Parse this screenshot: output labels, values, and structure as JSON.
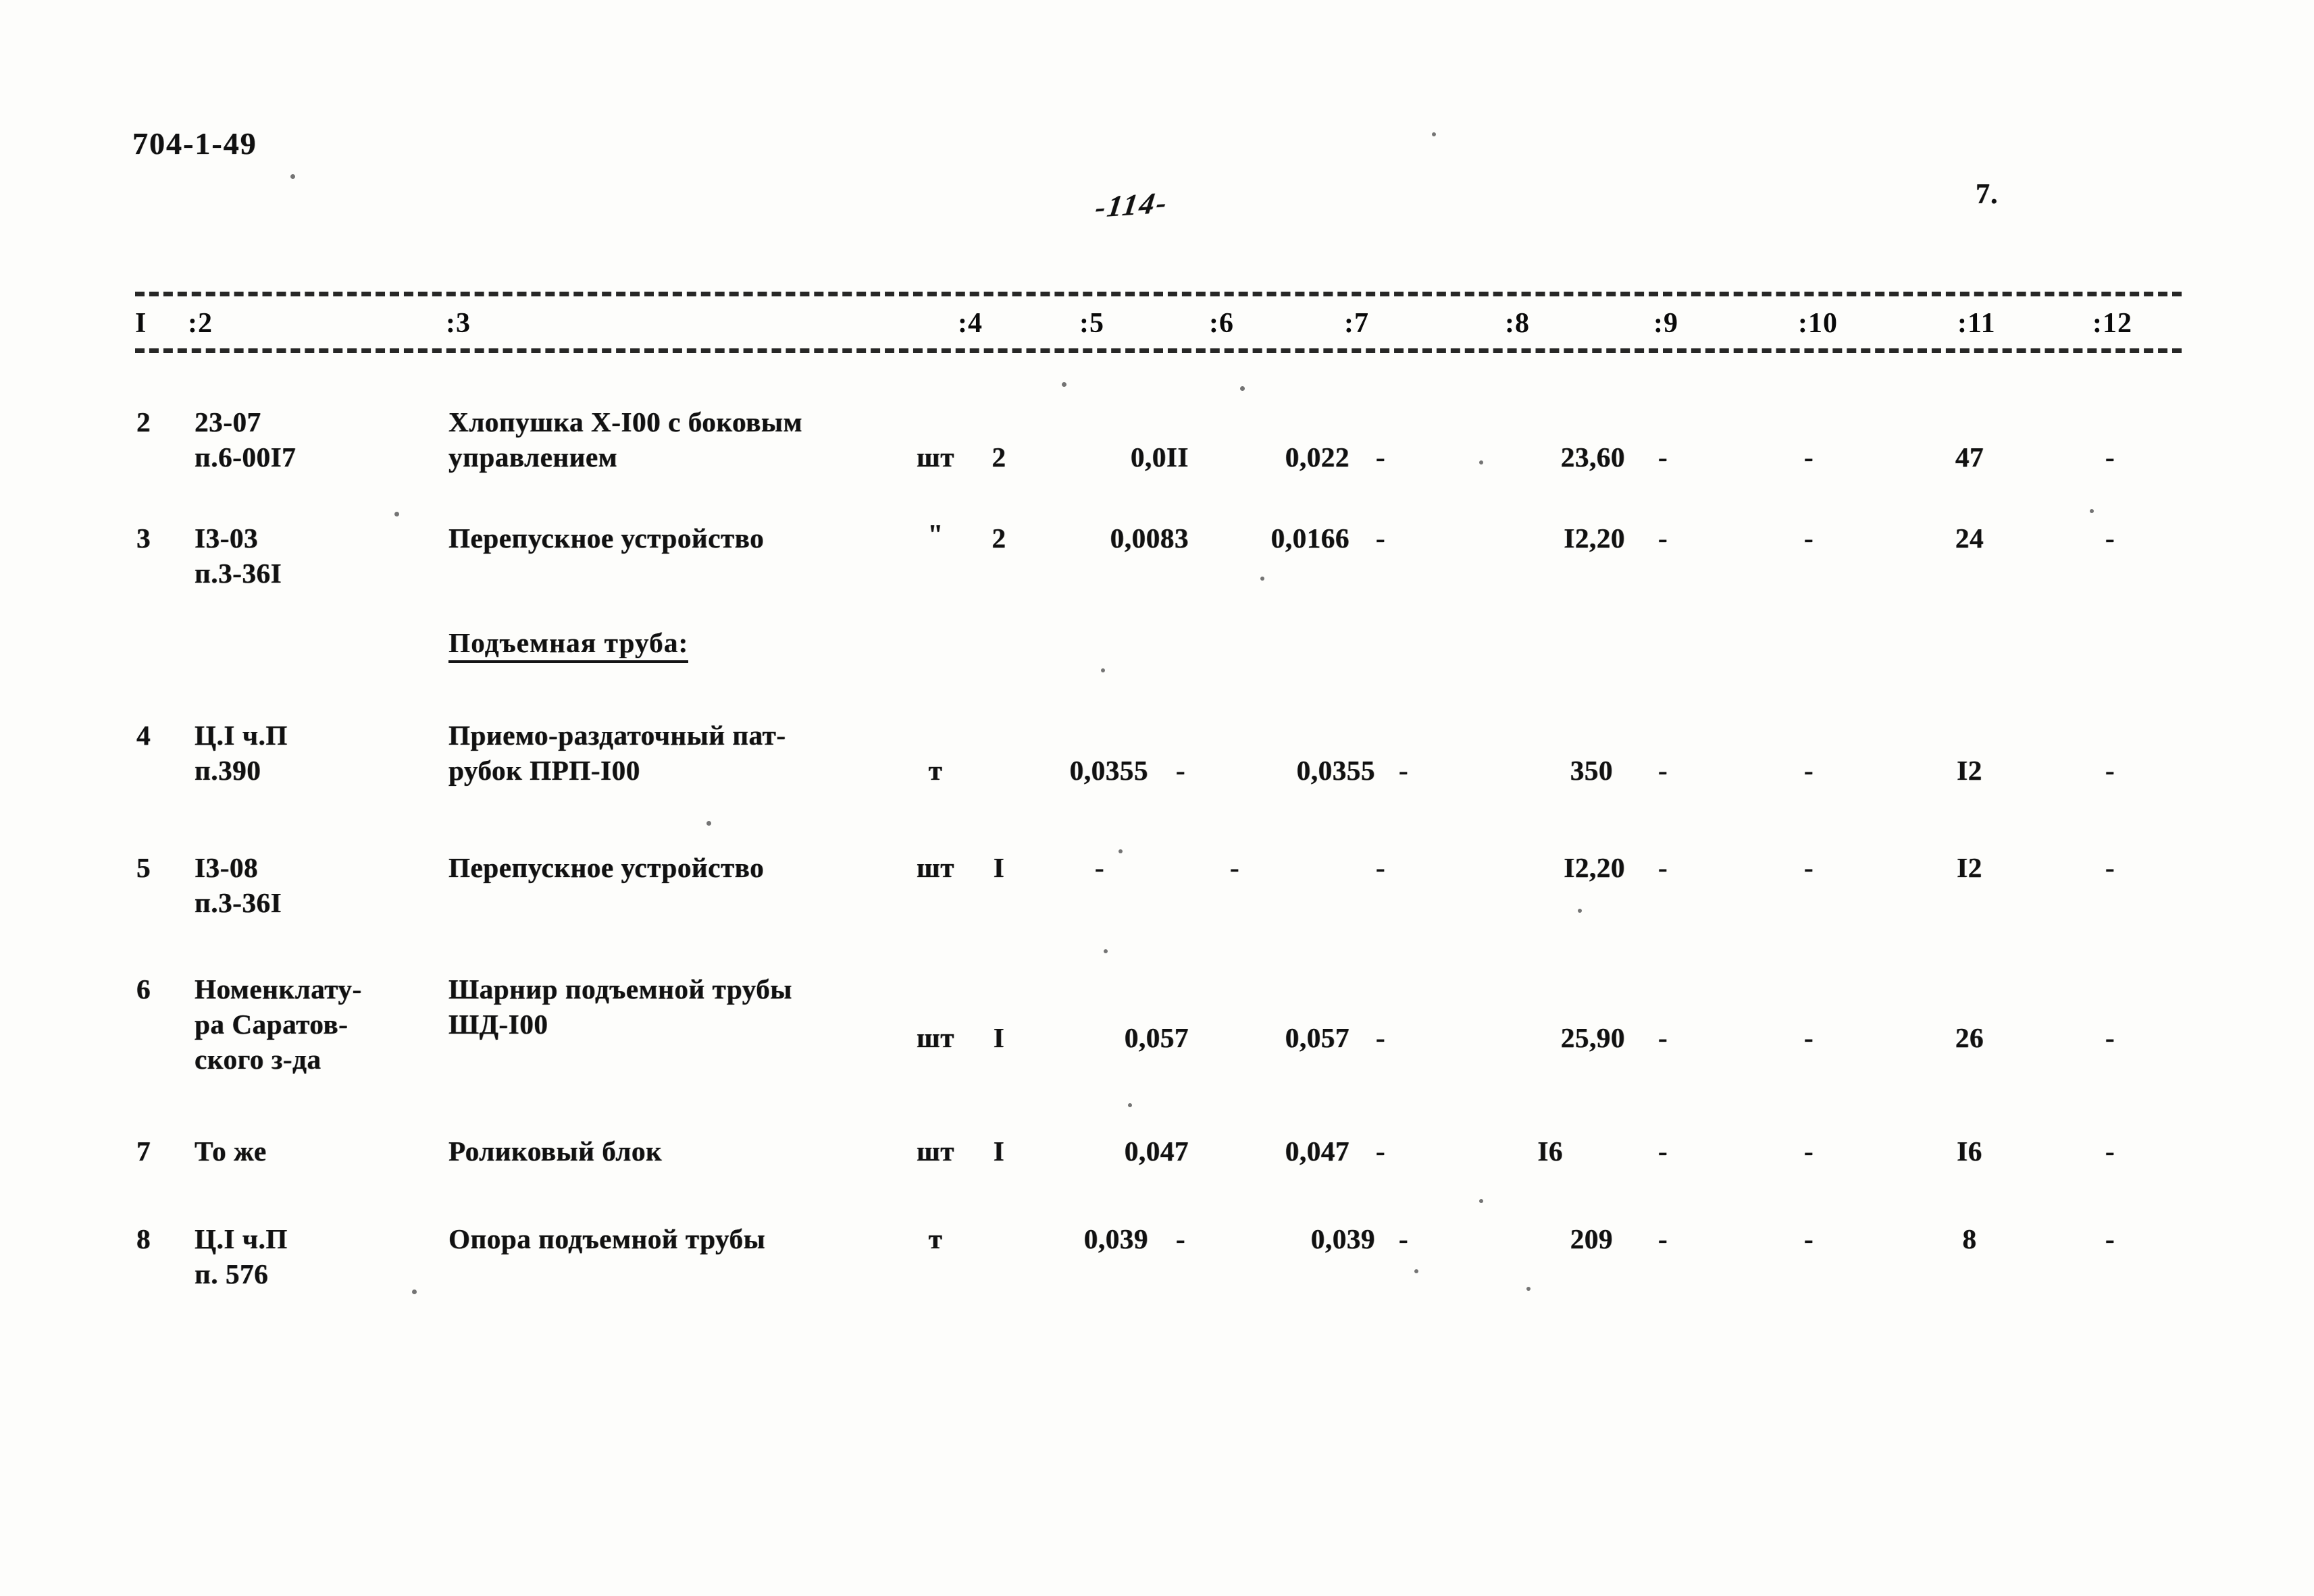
{
  "document": {
    "code": "704-1-49",
    "page_number_handwritten": "-114-",
    "sheet_number": "7."
  },
  "table": {
    "column_headers": [
      "I",
      ":2",
      ":3",
      ":4",
      ":5",
      ":6",
      ":7",
      ":8",
      ":9",
      ":10",
      ":11",
      ":12"
    ],
    "group_heading": "Подъемная труба:",
    "rows": [
      {
        "c1": "2",
        "c2_line1": "23-07",
        "c2_line2": "п.6-00I7",
        "c3_line1": "Хлопушка Х-I00 с боковым",
        "c3_line2": "управлением",
        "c4": "шт",
        "c5": "2",
        "c6": "0,0II",
        "c7": "0,022",
        "c8": "-",
        "c9": "23,60",
        "c10": "-",
        "c11": "-",
        "c12": "47",
        "c13": "-"
      },
      {
        "c1": "3",
        "c2_line1": "I3-03",
        "c2_line2": "п.3-36I",
        "c3_line1": "Перепускное устройство",
        "c3_line2": "",
        "c4": "\"",
        "c5": "2",
        "c6": "0,0083",
        "c7": "0,0166",
        "c8": "-",
        "c9": "I2,20",
        "c10": "-",
        "c11": "-",
        "c12": "24",
        "c13": "-"
      },
      {
        "c1": "4",
        "c2_line1": "Ц.I ч.П",
        "c2_line2": "п.390",
        "c3_line1": "Приемо-раздаточный пат-",
        "c3_line2": "рубок ПРП-I00",
        "c4": "т",
        "c5": "0,0355",
        "c6": "-",
        "c7": "0,0355",
        "c8": "-",
        "c9": "350",
        "c10": "-",
        "c11": "-",
        "c12": "I2",
        "c13": "-"
      },
      {
        "c1": "5",
        "c2_line1": "I3-08",
        "c2_line2": "п.3-36I",
        "c3_line1": "Перепускное устройство",
        "c3_line2": "",
        "c4": "шт",
        "c5": "I",
        "c6": "-",
        "c7": "-",
        "c8": "-",
        "c9": "I2,20",
        "c10": "-",
        "c11": "-",
        "c12": "I2",
        "c13": "-"
      },
      {
        "c1": "6",
        "c2_line1": "Номенклату-",
        "c2_line2": "ра Саратов-",
        "c2_line3": "ского з-да",
        "c3_line1": "Шарнир подъемной трубы",
        "c3_line2": "ШД-I00",
        "c4": "шт",
        "c5": "I",
        "c6": "0,057",
        "c7": "0,057",
        "c8": "-",
        "c9": "25,90",
        "c10": "-",
        "c11": "-",
        "c12": "26",
        "c13": "-"
      },
      {
        "c1": "7",
        "c2_line1": "То же",
        "c2_line2": "",
        "c3_line1": "Роликовый блок",
        "c3_line2": "",
        "c4": "шт",
        "c5": "I",
        "c6": "0,047",
        "c7": "0,047",
        "c8": "-",
        "c9": "I6",
        "c10": "-",
        "c11": "-",
        "c12": "I6",
        "c13": "-"
      },
      {
        "c1": "8",
        "c2_line1": "Ц.I ч.П",
        "c2_line2": "п. 576",
        "c3_line1": "Опора подъемной трубы",
        "c3_line2": "",
        "c4": "т",
        "c5": "0,039",
        "c6": "-",
        "c7": "0,039",
        "c8": "-",
        "c9": "209",
        "c10": "-",
        "c11": "-",
        "c12": "8",
        "c13": "-"
      }
    ]
  }
}
